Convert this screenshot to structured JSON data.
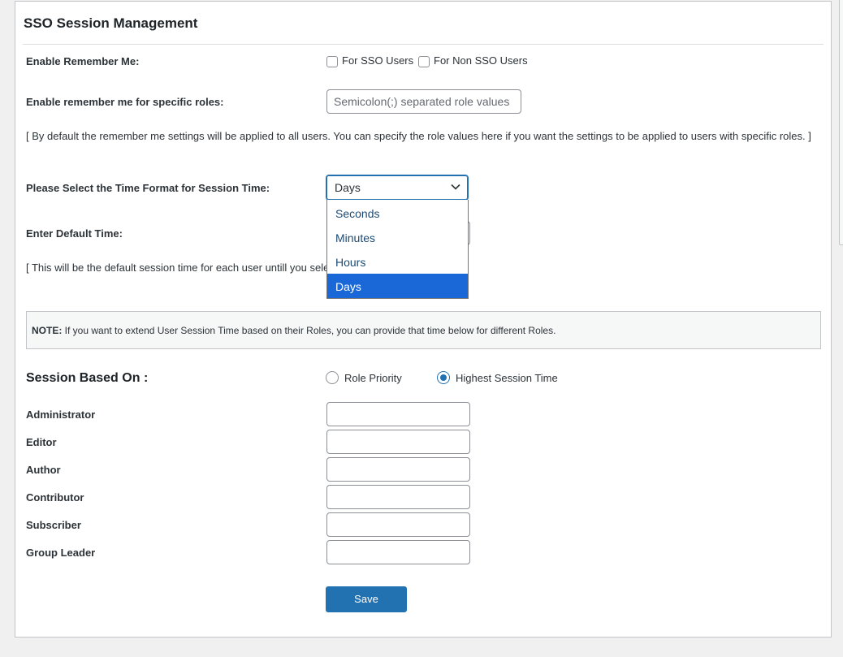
{
  "title": "SSO Session Management",
  "remember_me": {
    "label": "Enable Remember Me:",
    "sso_label": "For SSO Users",
    "sso_checked": false,
    "non_sso_label": "For Non SSO Users",
    "non_sso_checked": false
  },
  "roles_field": {
    "label": "Enable remember me for specific roles:",
    "value": "",
    "placeholder": "Semicolon(;) separated role values",
    "help": "[ By default the remember me settings will be applied to all users. You can specify the role values here if you want the settings to be applied to users with specific roles. ]"
  },
  "time_format": {
    "label": "Please Select the Time Format for Session Time:",
    "selected": "Days",
    "options": [
      "Seconds",
      "Minutes",
      "Hours",
      "Days"
    ],
    "expanded": true
  },
  "default_time": {
    "label": "Enter Default Time:",
    "help": "[ This will be the default session time for each user untill you sele"
  },
  "note": {
    "prefix": "NOTE:",
    "text": " If you want to extend User Session Time based on their Roles, you can provide that time below for different Roles."
  },
  "session_based_on": {
    "label": "Session Based On :",
    "options": [
      {
        "label": "Role Priority",
        "checked": false
      },
      {
        "label": "Highest Session Time",
        "checked": true
      }
    ]
  },
  "roles": [
    {
      "label": "Administrator",
      "value": ""
    },
    {
      "label": "Editor",
      "value": ""
    },
    {
      "label": "Author",
      "value": ""
    },
    {
      "label": "Contributor",
      "value": ""
    },
    {
      "label": "Subscriber",
      "value": ""
    },
    {
      "label": "Group Leader",
      "value": ""
    }
  ],
  "save_label": "Save",
  "colors": {
    "primary": "#2271b1",
    "dropdown_highlight": "#1a68d8"
  }
}
